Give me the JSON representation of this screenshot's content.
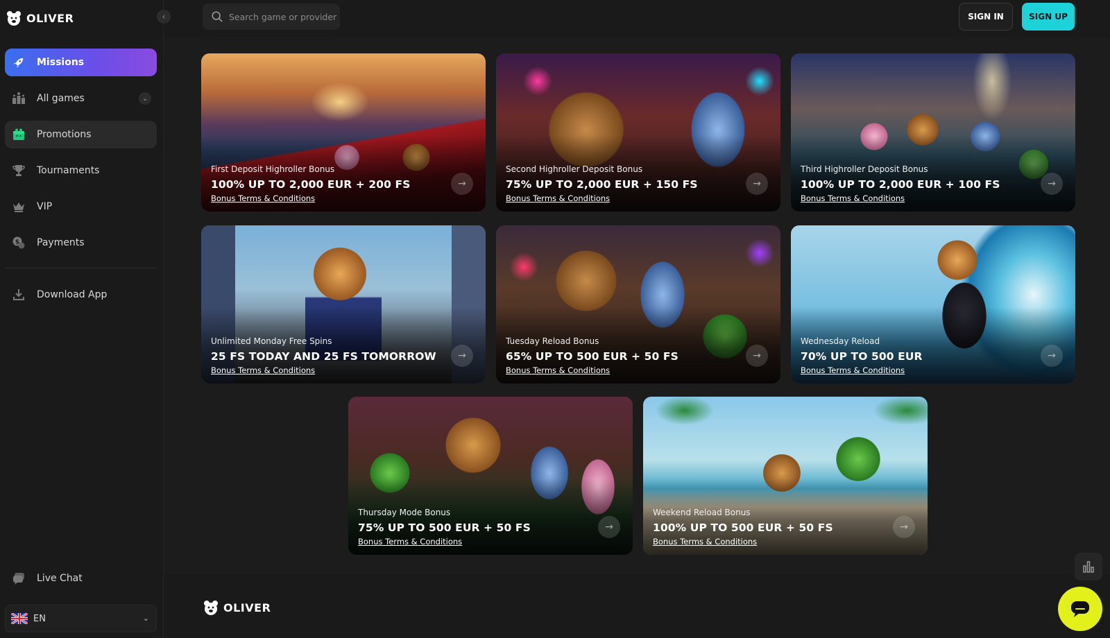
{
  "brand": {
    "name": "OLIVER"
  },
  "sidebar": {
    "items": [
      {
        "label": "Missions",
        "icon": "rocket-icon"
      },
      {
        "label": "All games",
        "icon": "games-icon"
      },
      {
        "label": "Promotions",
        "icon": "gift-icon"
      },
      {
        "label": "Tournaments",
        "icon": "trophy-icon"
      },
      {
        "label": "VIP",
        "icon": "crown-icon"
      },
      {
        "label": "Payments",
        "icon": "coins-icon"
      }
    ],
    "download_label": "Download App",
    "chat_label": "Live Chat",
    "language": "EN"
  },
  "header": {
    "search_placeholder": "Search game or provider",
    "signin_label": "SIGN IN",
    "signup_label": "SIGN UP"
  },
  "promotions": [
    {
      "subtitle": "First Deposit Highroller Bonus",
      "title": "100% UP TO 2,000 EUR + 200 FS",
      "terms": "Bonus Terms & Conditions"
    },
    {
      "subtitle": "Second Highroller Deposit Bonus",
      "title": "75% UP TO 2,000 EUR + 150 FS",
      "terms": "Bonus Terms & Conditions"
    },
    {
      "subtitle": "Third Highroller Deposit Bonus",
      "title": "100% UP TO 2,000 EUR + 100 FS",
      "terms": "Bonus Terms & Conditions"
    },
    {
      "subtitle": "Unlimited Monday Free Spins",
      "title": "25 FS TODAY AND 25 FS TOMORROW",
      "terms": "Bonus Terms & Conditions"
    },
    {
      "subtitle": "Tuesday Reload Bonus",
      "title": "65% UP TO 500 EUR + 50 FS",
      "terms": "Bonus Terms & Conditions"
    },
    {
      "subtitle": "Wednesday Reload",
      "title": "70% UP TO 500 EUR",
      "terms": "Bonus Terms & Conditions"
    },
    {
      "subtitle": "Thursday Mode Bonus",
      "title": "75% UP TO 500 EUR + 50 FS",
      "terms": "Bonus Terms & Conditions"
    },
    {
      "subtitle": "Weekend Reload Bonus",
      "title": "100% UP TO 500 EUR + 50 FS",
      "terms": "Bonus Terms & Conditions"
    }
  ],
  "colors": {
    "accent_cyan": "#1ed2d9",
    "chat_yellow": "#e3f01a",
    "missions_gradient_start": "#3a6ff0",
    "missions_gradient_end": "#8a4be0"
  }
}
